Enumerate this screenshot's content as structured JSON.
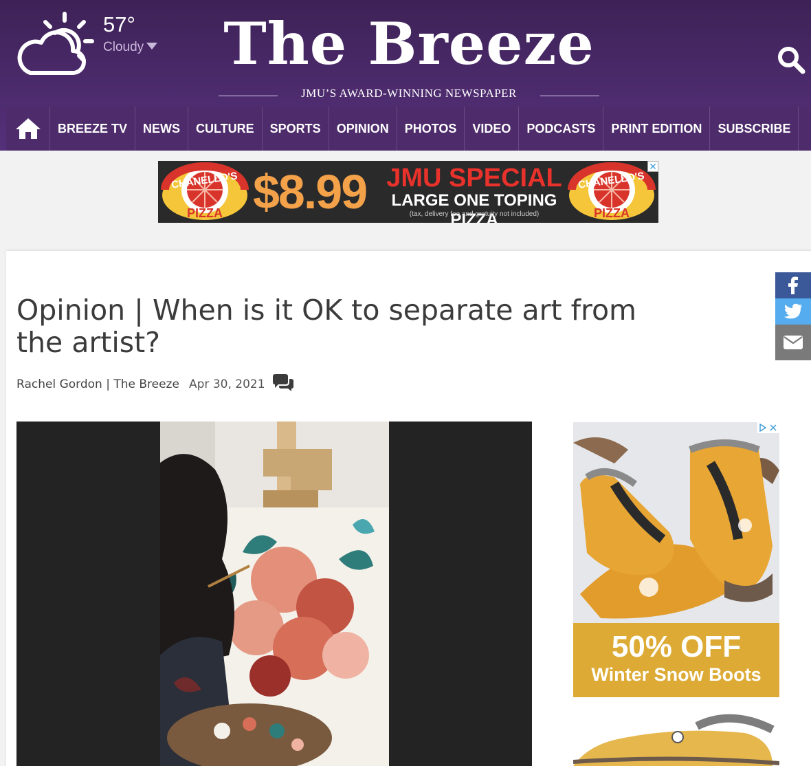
{
  "weather": {
    "temperature": "57°",
    "condition": "Cloudy",
    "icon": "partly-cloudy-icon"
  },
  "masthead": {
    "title": "The Breeze",
    "tagline": "JMU’S AWARD-WINNING NEWSPAPER"
  },
  "nav": {
    "home_icon": "home-icon",
    "items": [
      {
        "label": "BREEZE TV"
      },
      {
        "label": "NEWS"
      },
      {
        "label": "CULTURE"
      },
      {
        "label": "SPORTS"
      },
      {
        "label": "OPINION"
      },
      {
        "label": "PHOTOS"
      },
      {
        "label": "VIDEO"
      },
      {
        "label": "PODCASTS"
      },
      {
        "label": "PRINT EDITION"
      },
      {
        "label": "SUBSCRIBE"
      }
    ]
  },
  "top_ad": {
    "brand": "CHANELLO'S",
    "brand_sub": "PIZZA",
    "price": "$8.99",
    "headline": "JMU SPECIAL",
    "offer": "LARGE ONE TOPING PIZZA",
    "fine_print": "(tax, delivery fee and gratuity not included)"
  },
  "article": {
    "headline": "Opinion | When is it OK to separate art from the artist?",
    "byline": "Rachel Gordon | The Breeze",
    "date": "Apr 30, 2021"
  },
  "side_ad": {
    "discount": "50% OFF",
    "product": "Winter Snow Boots"
  },
  "colors": {
    "brand_purple": "#4e2b6b",
    "header_dark": "#3d2256",
    "ad_orange": "#f3a24a",
    "ad_red": "#e8322b",
    "boot_yellow": "#ddab35",
    "facebook": "#3b5998",
    "twitter": "#55acee",
    "email": "#7a7a7a"
  }
}
